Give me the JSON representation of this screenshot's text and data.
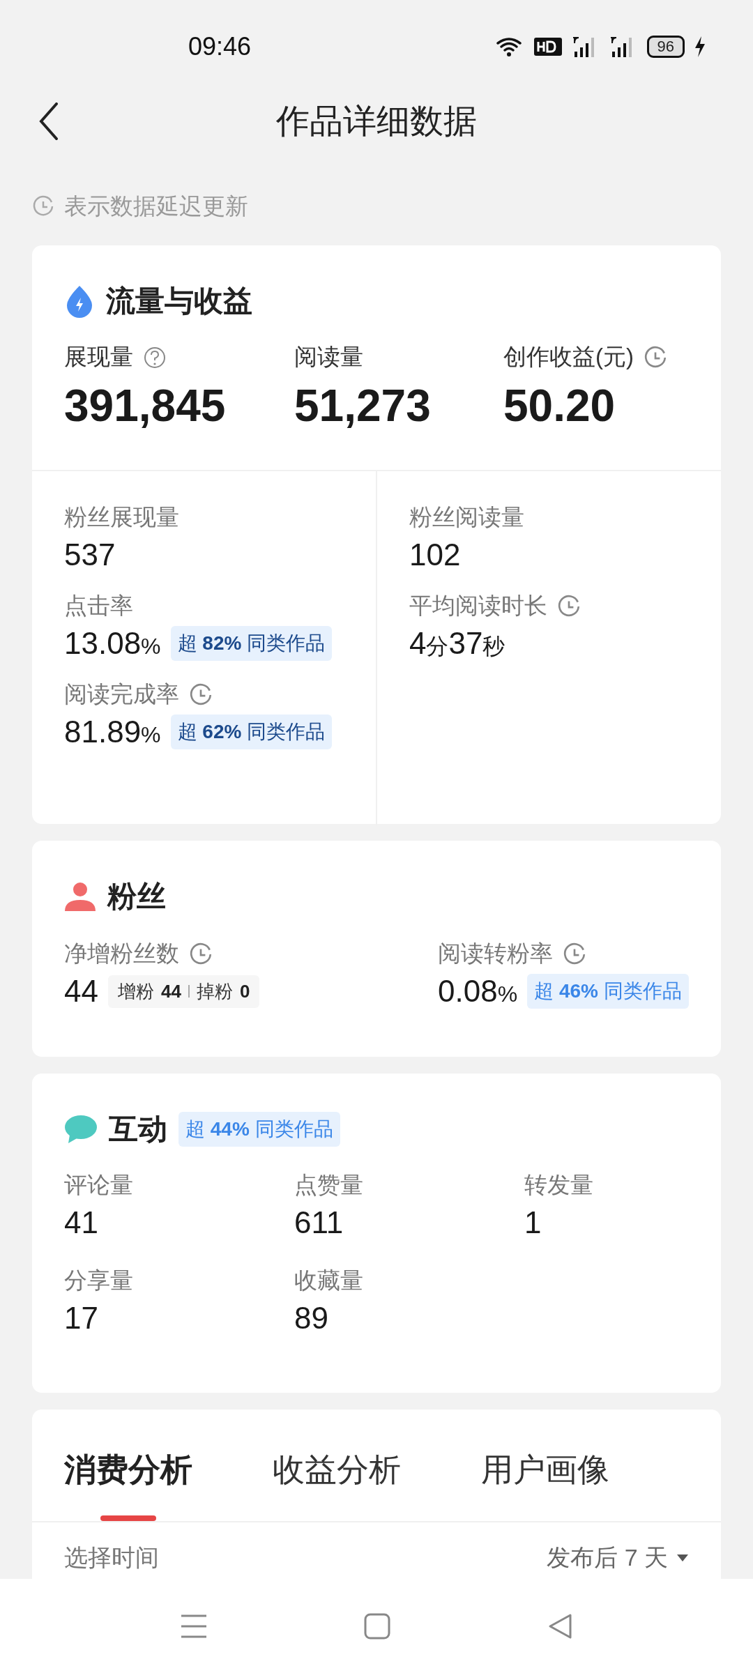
{
  "status_bar": {
    "time": "09:46",
    "battery": "96"
  },
  "header": {
    "title": "作品详细数据"
  },
  "notice": "表示数据延迟更新",
  "traffic": {
    "title": "流量与收益",
    "top_metrics": [
      {
        "label": "展现量",
        "value": "391,845",
        "help": true
      },
      {
        "label": "阅读量",
        "value": "51,273"
      },
      {
        "label": "创作收益(元)",
        "value": "50.20",
        "delayed": true
      }
    ],
    "left_metrics": [
      {
        "label": "粉丝展现量",
        "value": [
          {
            "text": "537",
            "kind": "number"
          }
        ]
      },
      {
        "label": "点击率",
        "value": [
          {
            "text": "13.08",
            "kind": "number"
          },
          {
            "text": "%",
            "kind": "unit"
          }
        ],
        "compare": "超 **82%** 同类作品"
      },
      {
        "label": "阅读完成率",
        "delayed": true,
        "value": [
          {
            "text": "81.89",
            "kind": "number"
          },
          {
            "text": "%",
            "kind": "unit"
          }
        ],
        "compare": "超 **62%** 同类作品"
      }
    ],
    "right_metrics": [
      {
        "label": "粉丝阅读量",
        "value": [
          {
            "text": "102",
            "kind": "number"
          }
        ]
      },
      {
        "label": "平均阅读时长",
        "delayed": true,
        "value": [
          {
            "text": "4",
            "kind": "number"
          },
          {
            "text": "分",
            "kind": "unit"
          },
          {
            "text": "37",
            "kind": "number"
          },
          {
            "text": "秒",
            "kind": "unit"
          }
        ]
      }
    ]
  },
  "fans": {
    "title": "粉丝",
    "metrics": [
      {
        "label": "净增粉丝数",
        "delayed": true,
        "value": [
          {
            "text": "44",
            "kind": "number"
          }
        ],
        "breakdown": [
          {
            "label": "增粉",
            "value": "44"
          },
          {
            "label": "掉粉",
            "value": "0"
          }
        ]
      },
      {
        "label": "阅读转粉率",
        "delayed": true,
        "value": [
          {
            "text": "0.08",
            "kind": "number"
          },
          {
            "text": "%",
            "kind": "unit"
          }
        ],
        "compare": "超 **46%** 同类作品"
      }
    ]
  },
  "interaction": {
    "title": "互动",
    "compare": "超 **44%** 同类作品",
    "metrics": [
      {
        "label": "评论量",
        "value": "41"
      },
      {
        "label": "点赞量",
        "value": "611"
      },
      {
        "label": "转发量",
        "value": "1"
      },
      {
        "label": "分享量",
        "value": "17"
      },
      {
        "label": "收藏量",
        "value": "89"
      }
    ]
  },
  "analysis": {
    "tabs": [
      {
        "label": "消费分析",
        "selected": true
      },
      {
        "label": "收益分析",
        "selected": false
      },
      {
        "label": "用户画像",
        "selected": false
      }
    ],
    "filter": {
      "label": "选择时间",
      "value": "发布后 7 天"
    }
  }
}
